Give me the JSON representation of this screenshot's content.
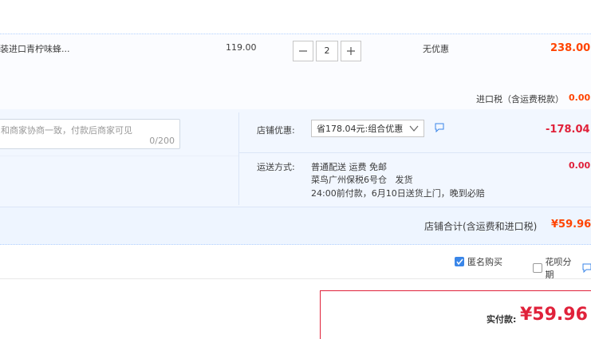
{
  "item": {
    "name": "装进口青柠味蜂...",
    "unit_price": "119.00",
    "quantity": "2",
    "discount_label": "无优惠",
    "subtotal": "238.00",
    "import_tax_label": "进口税（含运费税款）",
    "import_tax_value": "0.00"
  },
  "order": {
    "memo_placeholder": "和商家协商一致，付款后商家可见",
    "memo_count": "0/200",
    "shop_discount_label": "店铺优惠:",
    "shop_discount_option": "省178.04元:组合优惠",
    "shop_discount_value": "-178.04",
    "shipping_label": "运送方式:",
    "shipping_method": "普通配送 运费 免邮",
    "shipping_warehouse": "菜鸟广州保税6号仓   发货",
    "shipping_promise": "24:00前付款，6月10日送货上门，晚到必赔",
    "shipping_value": "0.00"
  },
  "shop_total": {
    "label": "店铺合计(含运费和进口税)",
    "value": "¥59.96"
  },
  "options": {
    "anonymous_label": "匿名购买",
    "anonymous_checked": true,
    "huabei_label": "花呗分期",
    "huabei_checked": false
  },
  "payment": {
    "label": "实付款:",
    "amount": "¥59.96"
  },
  "colors": {
    "price_orange": "#ff4400",
    "price_red": "#e0213a",
    "accent_blue": "#3a86e8"
  }
}
